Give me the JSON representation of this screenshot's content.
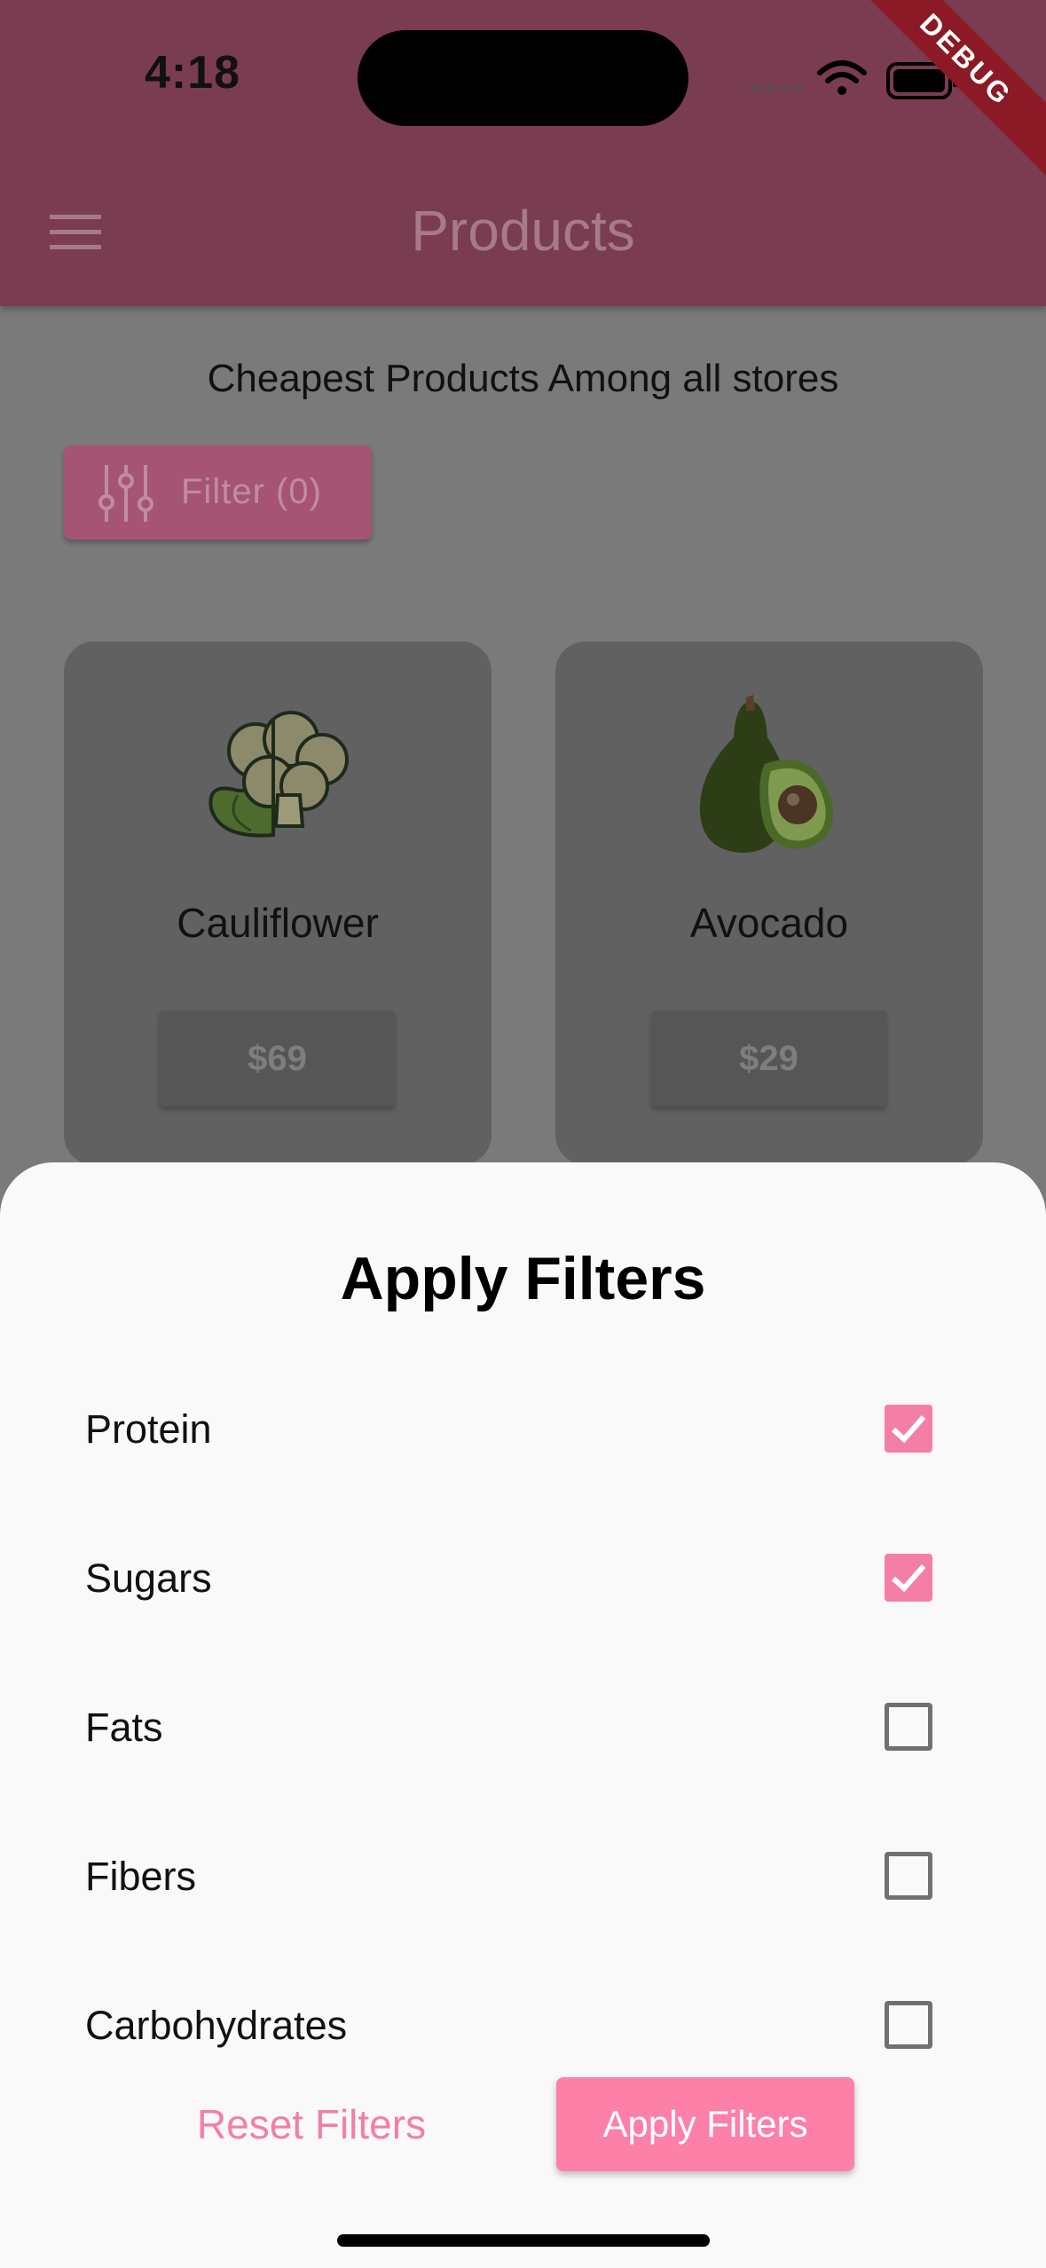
{
  "status_bar": {
    "time": "4:18",
    "debug_label": "DEBUG"
  },
  "app_bar": {
    "title": "Products",
    "menu_icon": "hamburger-menu-icon"
  },
  "page": {
    "subtitle": "Cheapest Products Among all stores",
    "filter_button_label": "Filter (0)",
    "products": [
      {
        "name": "Cauliflower",
        "price": "$69",
        "icon": "cauliflower-icon"
      },
      {
        "name": "Avocado",
        "price": "$29",
        "icon": "avocado-icon"
      }
    ]
  },
  "sheet": {
    "title": "Apply Filters",
    "filters": [
      {
        "label": "Protein",
        "checked": true
      },
      {
        "label": "Sugars",
        "checked": true
      },
      {
        "label": "Fats",
        "checked": false
      },
      {
        "label": "Fibers",
        "checked": false
      },
      {
        "label": "Carbohydrates",
        "checked": false
      }
    ],
    "reset_label": "Reset Filters",
    "apply_label": "Apply Filters"
  },
  "colors": {
    "app_bar": "#7a3c50",
    "accent_pink": "#fc80a8",
    "checkbox_checked": "#f47fa6",
    "sheet_background": "#f9f9f9"
  }
}
